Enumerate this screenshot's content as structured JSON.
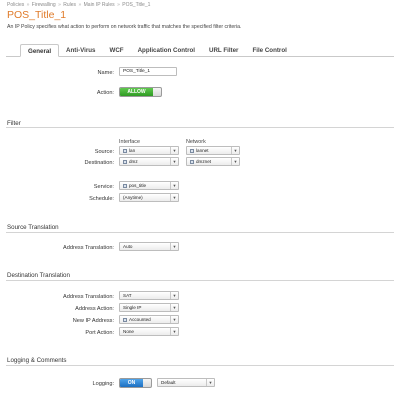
{
  "breadcrumb": {
    "items": [
      "Policies",
      "Firewalling",
      "Rules",
      "Main IP Rules",
      "POS_Title_1"
    ],
    "separator": "»"
  },
  "page": {
    "title": "POS_Title_1",
    "description": "An IP Policy specifies what action to perform on network traffic that matches the specified filter criteria."
  },
  "tabs": [
    {
      "label": "General",
      "active": true
    },
    {
      "label": "Anti-Virus"
    },
    {
      "label": "WCF"
    },
    {
      "label": "Application Control"
    },
    {
      "label": "URL Filter"
    },
    {
      "label": "File Control"
    }
  ],
  "general": {
    "name_label": "Name:",
    "name_value": "POS_Title_1",
    "action_label": "Action:",
    "action_value": "ALLOW"
  },
  "filter": {
    "heading": "Filter",
    "interface_header": "Interface",
    "network_header": "Network",
    "source_label": "Source:",
    "source_interface": "lan",
    "source_network": "lannet",
    "destination_label": "Destination:",
    "destination_interface": "dmz",
    "destination_network": "dmznet",
    "service_label": "Service:",
    "service_value": "pos_title",
    "schedule_label": "Schedule:",
    "schedule_value": "(Anytime)"
  },
  "source_translation": {
    "heading": "Source Translation",
    "address_translation_label": "Address Translation:",
    "address_translation_value": "Auto"
  },
  "destination_translation": {
    "heading": "Destination Translation",
    "address_translation_label": "Address Translation:",
    "address_translation_value": "SAT",
    "address_action_label": "Address Action:",
    "address_action_value": "Single IP",
    "new_ip_label": "New IP Address:",
    "new_ip_value": "Accounted",
    "port_action_label": "Port Action:",
    "port_action_value": "None"
  },
  "logging": {
    "heading": "Logging & Comments",
    "logging_label": "Logging:",
    "logging_value": "ON",
    "log_target_value": "Default"
  },
  "colors": {
    "title": "#e07b2a",
    "allow_green": "#2f9a23",
    "on_blue": "#1d6fc1",
    "rule": "#d4d4d4"
  }
}
